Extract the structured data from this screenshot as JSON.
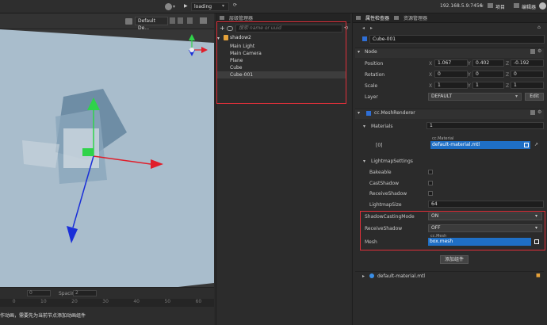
{
  "topbar": {
    "loading_label": "loading",
    "ip_address": "192.168.5.9:7456",
    "project_label": "项目",
    "editor_label": "编辑器"
  },
  "scene": {
    "view_label": "Default De...",
    "spacing_label": "Spacing:",
    "spacing_value": "2",
    "frame_value": "0",
    "ticks": [
      "0",
      "10",
      "20",
      "30",
      "40",
      "50",
      "60"
    ],
    "bottom_message": "作动画，需要先为当前节点添加动画组件"
  },
  "hierarchy": {
    "title": "层级管理器",
    "search_placeholder": "搜索 name or uuid",
    "root": "shadow2",
    "items": [
      "Main Light",
      "Main Camera",
      "Plane",
      "Cube",
      "Cube-001"
    ]
  },
  "inspector": {
    "tabs": [
      "属性检查器",
      "资源管理器"
    ],
    "node_name": "Cube-001",
    "node_section": "Node",
    "position": {
      "label": "Position",
      "x": "1.067",
      "y": "0.402",
      "z": "-0.192"
    },
    "rotation": {
      "label": "Rotation",
      "x": "0",
      "y": "0",
      "z": "0"
    },
    "scale": {
      "label": "Scale",
      "x": "1",
      "y": "1",
      "z": "1"
    },
    "layer": {
      "label": "Layer",
      "value": "DEFAULT",
      "edit": "Edit"
    },
    "component": "cc.MeshRenderer",
    "materials": {
      "label": "Materials",
      "count": "1",
      "index": "[0]",
      "type": "cc.Material",
      "value": "default-material.mtl"
    },
    "lightmap": {
      "section": "LightmapSettings",
      "bakeable": "Bakeable",
      "castshadow": "CastShadow",
      "receiveshadow": "ReceiveShadow",
      "size_label": "LightmapSize",
      "size_value": "64"
    },
    "shadow_casting": {
      "label": "ShadowCastingMode",
      "value": "ON"
    },
    "receive_shadow": {
      "label": "ReceiveShadow",
      "value": "OFF"
    },
    "mesh": {
      "label": "Mesh",
      "type": "cc.Mesh",
      "value": "box.mesh"
    },
    "add_component": "添加组件",
    "footer_asset": "default-material.mtl"
  },
  "colors": {
    "accent": "#1f6fc5",
    "highlight_red": "#e0303a",
    "gizmo_green": "#2fd34a",
    "gizmo_red": "#e01e2a",
    "gizmo_blue": "#1a2fd8"
  }
}
